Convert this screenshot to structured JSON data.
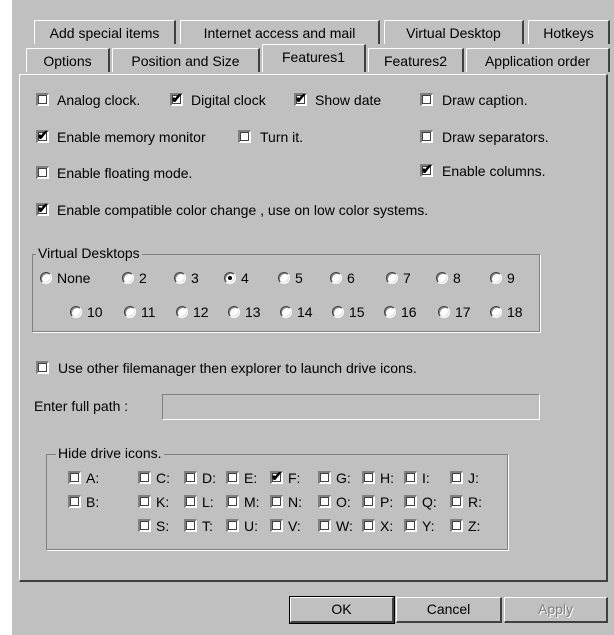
{
  "tabs_row1": [
    {
      "label": "Add special items"
    },
    {
      "label": "Internet access and mail"
    },
    {
      "label": "Virtual Desktop"
    },
    {
      "label": "Hotkeys"
    }
  ],
  "tabs_row2": [
    {
      "label": "Options"
    },
    {
      "label": "Position and Size"
    },
    {
      "label": "Features1",
      "active": true
    },
    {
      "label": "Features2"
    },
    {
      "label": "Application order"
    }
  ],
  "options": {
    "analog_clock": {
      "label": "Analog clock.",
      "checked": false
    },
    "digital_clock": {
      "label": "Digital clock",
      "checked": true
    },
    "show_date": {
      "label": "Show date",
      "checked": true
    },
    "draw_caption": {
      "label": "Draw caption.",
      "checked": false
    },
    "memory_monitor": {
      "label": "Enable memory monitor",
      "checked": true
    },
    "turn_it": {
      "label": "Turn it.",
      "checked": false
    },
    "draw_separators": {
      "label": "Draw separators.",
      "checked": false
    },
    "floating_mode": {
      "label": "Enable floating mode.",
      "checked": false
    },
    "enable_columns": {
      "label": "Enable columns.",
      "checked": true
    },
    "compatible_color": {
      "label": "Enable compatible color change , use on low color systems.",
      "checked": true
    }
  },
  "virtual_desktops": {
    "title": "Virtual Desktops",
    "selected": "4",
    "row1": [
      "None",
      "2",
      "3",
      "4",
      "5",
      "6",
      "7",
      "8",
      "9"
    ],
    "row2": [
      "10",
      "11",
      "12",
      "13",
      "14",
      "15",
      "16",
      "17",
      "18"
    ]
  },
  "filemanager": {
    "label": "Use other filemanager then explorer to launch drive icons.",
    "checked": false,
    "path_label": "Enter full path :",
    "path_value": ""
  },
  "hide_drive_icons": {
    "title": "Hide drive icons.",
    "rows": [
      [
        "A:",
        null,
        "C:",
        "D:",
        "E:",
        "F:",
        "G:",
        "H:",
        "I:",
        "J:"
      ],
      [
        "B:",
        null,
        "K:",
        "L:",
        "M:",
        "N:",
        "O:",
        "P:",
        "Q:",
        "R:"
      ],
      [
        null,
        null,
        "S:",
        "T:",
        "U:",
        "V:",
        "W:",
        "X:",
        "Y:",
        "Z:"
      ]
    ],
    "checked": [
      "F:"
    ]
  },
  "buttons": {
    "ok": "OK",
    "cancel": "Cancel",
    "apply": "Apply"
  }
}
